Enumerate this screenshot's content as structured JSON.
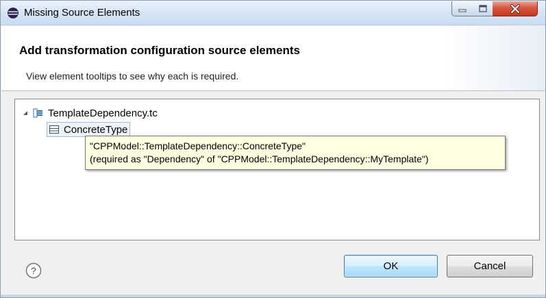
{
  "window": {
    "title": "Missing Source Elements",
    "icon": "eclipse-icon",
    "controls": {
      "minimize": "minimize-icon",
      "maximize": "maximize-icon",
      "close": "close-icon",
      "close_color": "#c6381e"
    }
  },
  "header": {
    "title": "Add transformation configuration source elements",
    "description": "View element tooltips to see why each is required."
  },
  "tree": {
    "root": {
      "label": "TemplateDependency.tc",
      "icon": "transformation-config-icon",
      "expanded": true
    },
    "children": [
      {
        "label": "ConcreteType",
        "icon": "class-element-icon",
        "selected": true
      }
    ]
  },
  "tooltip": {
    "line1": "\"CPPModel::TemplateDependency::ConcreteType\"",
    "line2": "(required as \"Dependency\" of \"CPPModel::TemplateDependency::MyTemplate\")",
    "background": "#ffffe1"
  },
  "footer": {
    "help_icon": "help-icon",
    "ok_label": "OK",
    "cancel_label": "Cancel"
  },
  "colors": {
    "titlebar": "#d7e6f6",
    "ok_border": "#3c7fb1",
    "tree_border": "#828790"
  }
}
